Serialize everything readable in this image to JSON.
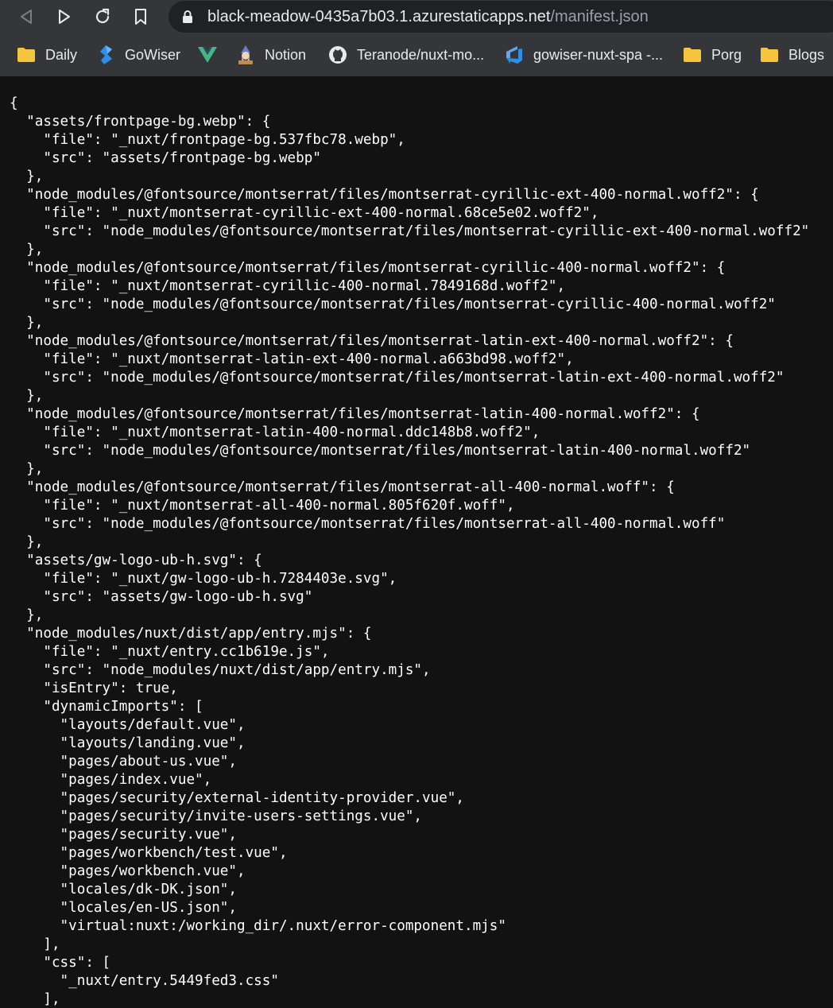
{
  "browser": {
    "url": {
      "domain": "black-meadow-0435a7b03.1.azurestaticapps.net",
      "path": "/manifest.json"
    },
    "bookmarks": [
      {
        "label": "Daily",
        "icon": "folder-icon"
      },
      {
        "label": "GoWiser",
        "icon": "gowiser-icon"
      },
      {
        "label": "",
        "icon": "vue-icon"
      },
      {
        "label": "Notion",
        "icon": "notion-icon"
      },
      {
        "label": "Teranode/nuxt-mo...",
        "icon": "github-icon"
      },
      {
        "label": "gowiser-nuxt-spa -...",
        "icon": "azure-devops-icon"
      },
      {
        "label": "Porg",
        "icon": "folder-icon"
      },
      {
        "label": "Blogs",
        "icon": "folder-icon"
      }
    ]
  },
  "json_lines": [
    "{",
    "  \"assets/frontpage-bg.webp\": {",
    "    \"file\": \"_nuxt/frontpage-bg.537fbc78.webp\",",
    "    \"src\": \"assets/frontpage-bg.webp\"",
    "  },",
    "  \"node_modules/@fontsource/montserrat/files/montserrat-cyrillic-ext-400-normal.woff2\": {",
    "    \"file\": \"_nuxt/montserrat-cyrillic-ext-400-normal.68ce5e02.woff2\",",
    "    \"src\": \"node_modules/@fontsource/montserrat/files/montserrat-cyrillic-ext-400-normal.woff2\"",
    "  },",
    "  \"node_modules/@fontsource/montserrat/files/montserrat-cyrillic-400-normal.woff2\": {",
    "    \"file\": \"_nuxt/montserrat-cyrillic-400-normal.7849168d.woff2\",",
    "    \"src\": \"node_modules/@fontsource/montserrat/files/montserrat-cyrillic-400-normal.woff2\"",
    "  },",
    "  \"node_modules/@fontsource/montserrat/files/montserrat-latin-ext-400-normal.woff2\": {",
    "    \"file\": \"_nuxt/montserrat-latin-ext-400-normal.a663bd98.woff2\",",
    "    \"src\": \"node_modules/@fontsource/montserrat/files/montserrat-latin-ext-400-normal.woff2\"",
    "  },",
    "  \"node_modules/@fontsource/montserrat/files/montserrat-latin-400-normal.woff2\": {",
    "    \"file\": \"_nuxt/montserrat-latin-400-normal.ddc148b8.woff2\",",
    "    \"src\": \"node_modules/@fontsource/montserrat/files/montserrat-latin-400-normal.woff2\"",
    "  },",
    "  \"node_modules/@fontsource/montserrat/files/montserrat-all-400-normal.woff\": {",
    "    \"file\": \"_nuxt/montserrat-all-400-normal.805f620f.woff\",",
    "    \"src\": \"node_modules/@fontsource/montserrat/files/montserrat-all-400-normal.woff\"",
    "  },",
    "  \"assets/gw-logo-ub-h.svg\": {",
    "    \"file\": \"_nuxt/gw-logo-ub-h.7284403e.svg\",",
    "    \"src\": \"assets/gw-logo-ub-h.svg\"",
    "  },",
    "  \"node_modules/nuxt/dist/app/entry.mjs\": {",
    "    \"file\": \"_nuxt/entry.cc1b619e.js\",",
    "    \"src\": \"node_modules/nuxt/dist/app/entry.mjs\",",
    "    \"isEntry\": true,",
    "    \"dynamicImports\": [",
    "      \"layouts/default.vue\",",
    "      \"layouts/landing.vue\",",
    "      \"pages/about-us.vue\",",
    "      \"pages/index.vue\",",
    "      \"pages/security/external-identity-provider.vue\",",
    "      \"pages/security/invite-users-settings.vue\",",
    "      \"pages/security.vue\",",
    "      \"pages/workbench/test.vue\",",
    "      \"pages/workbench.vue\",",
    "      \"locales/dk-DK.json\",",
    "      \"locales/en-US.json\",",
    "      \"virtual:nuxt:/working_dir/.nuxt/error-component.mjs\"",
    "    ],",
    "    \"css\": [",
    "      \"_nuxt/entry.5449fed3.css\"",
    "    ],"
  ]
}
